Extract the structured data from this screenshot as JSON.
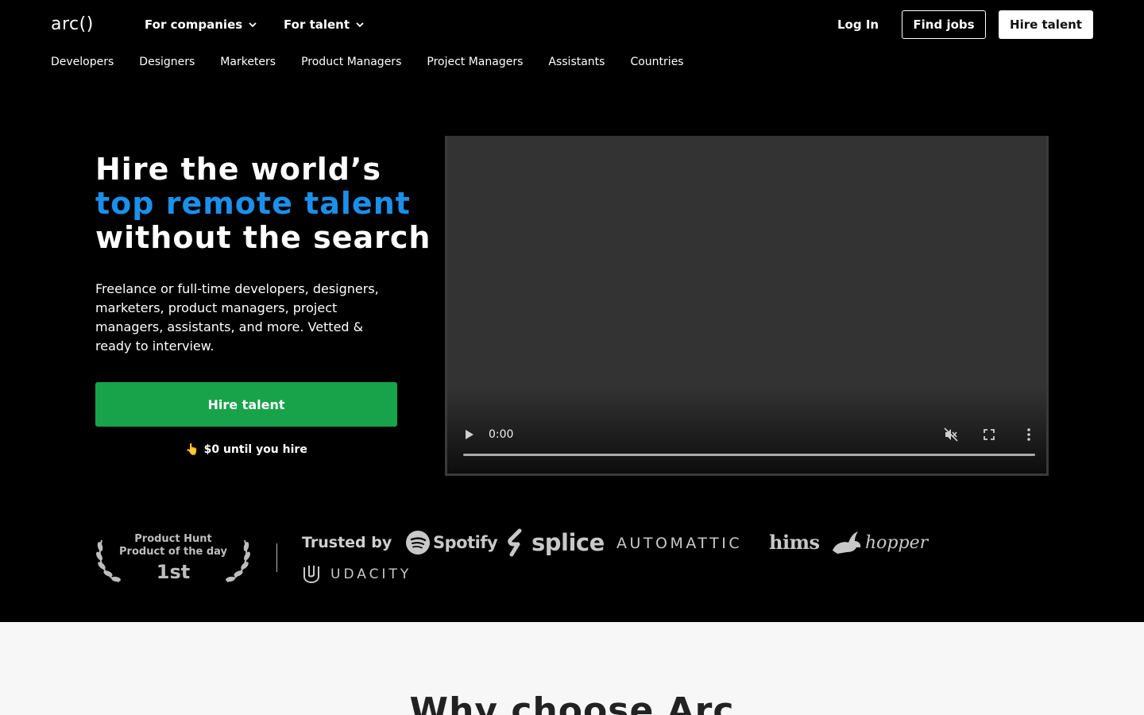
{
  "header": {
    "logo": "arc()",
    "nav": [
      {
        "label": "For companies"
      },
      {
        "label": "For talent"
      }
    ],
    "login_label": "Log In",
    "find_jobs_label": "Find jobs",
    "hire_label": "Hire talent"
  },
  "subnav": [
    "Developers",
    "Designers",
    "Marketers",
    "Product Managers",
    "Project Managers",
    "Assistants",
    "Countries"
  ],
  "hero": {
    "title_line1": "Hire the world’s",
    "title_line2": "top remote talent",
    "title_line3": "without the search",
    "accent_color": "#1b90ea",
    "description": "Freelance or full-time developers, designers, marketers, product managers, project managers, assistants, and more. Vetted & ready to interview.",
    "cta_label": "Hire talent",
    "cta_color": "#18a34a",
    "hint_icon": "👆",
    "hint_text": "$0 until you hire"
  },
  "video": {
    "time": "0:00",
    "progress": 0
  },
  "badge": {
    "line1": "Product Hunt",
    "line2": "Product of the day",
    "line3": "1st"
  },
  "trusted": {
    "label": "Trusted by",
    "brands": [
      "Spotify",
      "splice",
      "AUTOMATTIC",
      "hims",
      "hopper",
      "UDACITY"
    ]
  },
  "why": {
    "heading": "Why choose Arc"
  }
}
